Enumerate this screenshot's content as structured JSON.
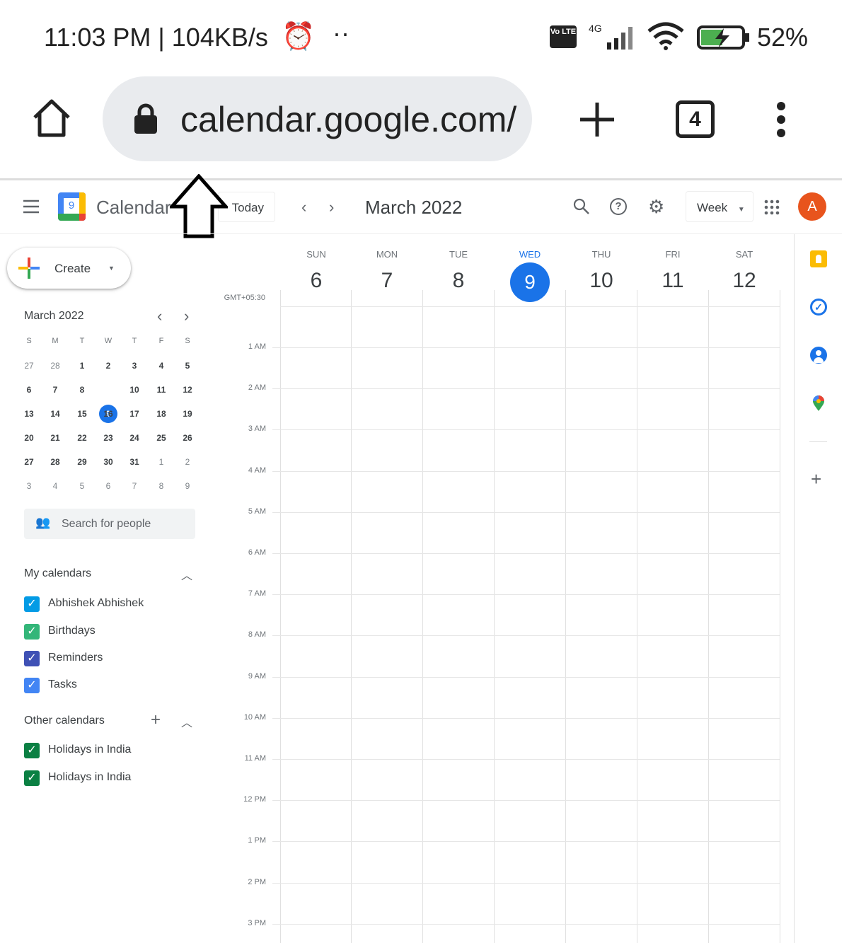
{
  "status_bar": {
    "time": "11:03 PM | 104KB/s",
    "dots": "··",
    "volte": "Vo LTE",
    "network": "4G",
    "battery": "52%"
  },
  "browser": {
    "url": "calendar.google.com/",
    "tab_count": "4"
  },
  "header": {
    "app_name": "Calendar",
    "logo_day": "9",
    "today_label": "Today",
    "period": "March 2022",
    "view": "Week",
    "avatar_initial": "A",
    "avatar_color": "#e8541d"
  },
  "sidebar": {
    "create_label": "Create",
    "mini_cal": {
      "title": "March 2022",
      "weekdays": [
        "S",
        "M",
        "T",
        "W",
        "T",
        "F",
        "S"
      ],
      "weeks": [
        [
          "27",
          "28",
          "1",
          "2",
          "3",
          "4",
          "5"
        ],
        [
          "6",
          "7",
          "8",
          "9",
          "10",
          "11",
          "12"
        ],
        [
          "13",
          "14",
          "15",
          "16",
          "17",
          "18",
          "19"
        ],
        [
          "20",
          "21",
          "22",
          "23",
          "24",
          "25",
          "26"
        ],
        [
          "27",
          "28",
          "29",
          "30",
          "31",
          "1",
          "2"
        ],
        [
          "3",
          "4",
          "5",
          "6",
          "7",
          "8",
          "9"
        ]
      ],
      "selected": "9"
    },
    "search_people_placeholder": "Search for people",
    "my_calendars_label": "My calendars",
    "my_calendars": [
      {
        "name": "Abhishek Abhishek",
        "color": "#039be5"
      },
      {
        "name": "Birthdays",
        "color": "#33b679"
      },
      {
        "name": "Reminders",
        "color": "#3f51b5"
      },
      {
        "name": "Tasks",
        "color": "#4285f4"
      }
    ],
    "other_calendars_label": "Other calendars",
    "other_calendars": [
      {
        "name": "Holidays in India",
        "color": "#0b8043"
      },
      {
        "name": "Holidays in India",
        "color": "#0b8043"
      }
    ]
  },
  "week": {
    "timezone": "GMT+05:30",
    "days": [
      {
        "name": "SUN",
        "num": "6"
      },
      {
        "name": "MON",
        "num": "7"
      },
      {
        "name": "TUE",
        "num": "8"
      },
      {
        "name": "WED",
        "num": "9",
        "today": true
      },
      {
        "name": "THU",
        "num": "10"
      },
      {
        "name": "FRI",
        "num": "11"
      },
      {
        "name": "SAT",
        "num": "12"
      }
    ],
    "hours": [
      "1 AM",
      "2 AM",
      "3 AM",
      "4 AM",
      "5 AM",
      "6 AM",
      "7 AM",
      "8 AM",
      "9 AM",
      "10 AM",
      "11 AM",
      "12 PM",
      "1 PM",
      "2 PM",
      "3 PM"
    ]
  },
  "side_panel": {
    "icons": [
      "keep-icon",
      "tasks-icon",
      "contacts-icon",
      "maps-icon",
      "add-icon"
    ]
  }
}
